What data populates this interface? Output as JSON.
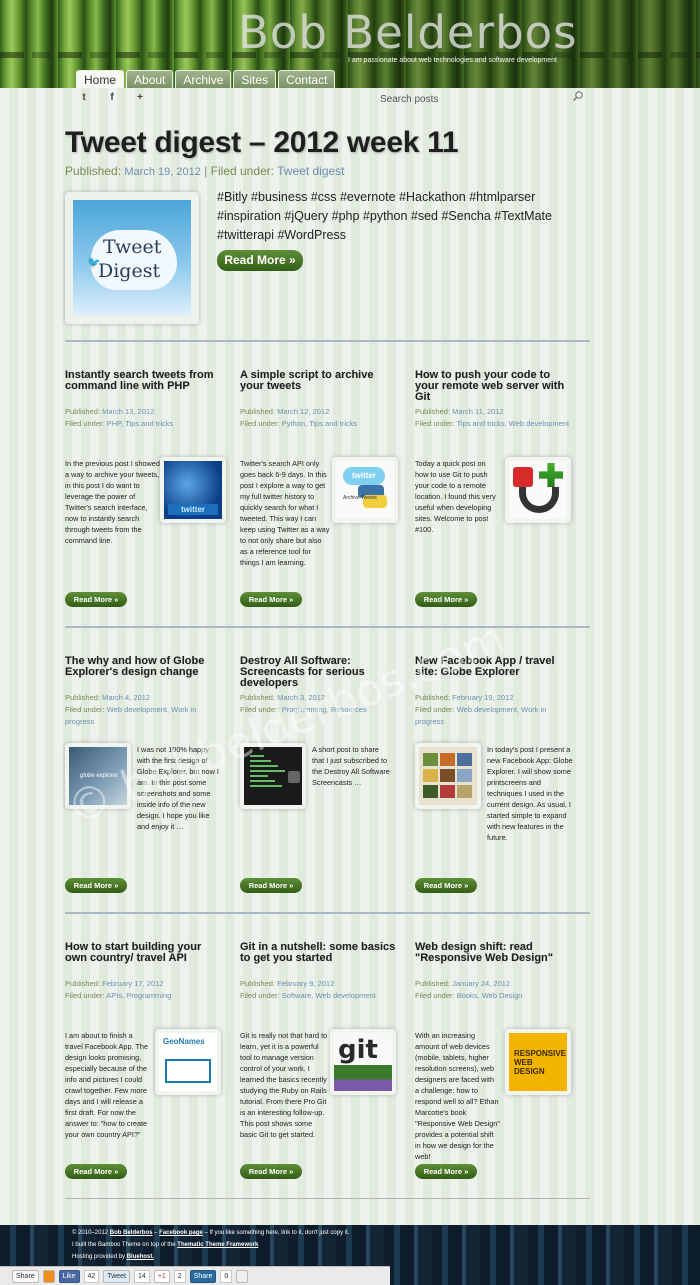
{
  "site": {
    "title": "Bob Belderbos",
    "description": "I am passionate about web technologies and software development"
  },
  "nav": {
    "tabs": [
      "Home",
      "About",
      "Archive",
      "Sites",
      "Contact"
    ],
    "active": "Home"
  },
  "social": [
    "t",
    "f",
    "+"
  ],
  "search": {
    "placeholder": "Search posts"
  },
  "featured": {
    "title": "Tweet digest – 2012 week 11",
    "published_label": "Published:",
    "date": "March 19, 2012",
    "separator": "|",
    "filed_label": "Filed under:",
    "category": "Tweet digest",
    "thumb_line1": "Tweet",
    "thumb_line2": "Digest",
    "tags": "#Bitly #business #css #evernote #Hackathon #htmlparser #inspiration #jQuery #php #python #sed #Sencha #TextMate #twitterapi #WordPress",
    "read_more": "Read More »"
  },
  "labels": {
    "published": "Published:",
    "filed": "Filed under:",
    "read_more": "Read More »"
  },
  "posts": [
    {
      "title": "Instantly search tweets from command line with PHP",
      "date": "March 13, 2012",
      "categories": "PHP, Tips and tricks",
      "excerpt": "In the previous post I showed a way to archive your tweets, in this post I do want to leverage the power of Twitter's search interface, now to instantly search through tweets from the command line.",
      "thumb_text": "twitter"
    },
    {
      "title": "A simple script to archive your tweets",
      "date": "March 12, 2012",
      "categories": "Python, Tips and tricks",
      "excerpt": "Twitter's search API only goes back 6-9 days. In this post I explore a way to get my full twitter history to quickly search for what I tweeted. This way I can keep using Twitter as a way to not only share but also as a reference tool for things I am learning.",
      "thumb_text": "twitter",
      "thumb_label": "Archive Tweets"
    },
    {
      "title": "How to push your code to your remote web server with Git",
      "date": "March 11, 2012",
      "categories": "Tips and tricks, Web development",
      "excerpt": "Today a quick post on how to use Git to push your code to a remote location. I found this very useful when developing sites. Welcome to post #100."
    },
    {
      "title": "The why and how of Globe Explorer's design change",
      "date": "March 4, 2012",
      "categories": "Web development, Work in progress",
      "excerpt": "I was not 100% happy with the first design of Globe Explorer, but now I am. In this post some screenshots and some inside info of the new design. I hope you like and enjoy it …",
      "thumb_text": "globe explorer"
    },
    {
      "title": "Destroy All Software: Screencasts for serious developers",
      "date": "March 3, 2012",
      "categories": "Programming, Resources",
      "excerpt": "A short post to share that I just subscribed to the Destroy All Software Screencasts …"
    },
    {
      "title": "New Facebook App / travel site: Globe Explorer",
      "date": "February 19, 2012",
      "categories": "Web development, Work in progress",
      "excerpt": "In today's post I present a new Facebook App: Globe Explorer. I will show some printscreens and techniques I used in the current design. As usual, I started simple to expand with new features in the future."
    },
    {
      "title": "How to start building your own country/ travel API",
      "date": "February 17, 2012",
      "categories": "APIs, Programming",
      "excerpt": "I am about to finish a travel Facebook App. The design looks promising, especially because of the info and pictures I could crawl together. Few more days and I will release a first draft. For now the answer to: \"how to create your own country API?\"",
      "thumb_text": "GeoNames"
    },
    {
      "title": "Git in a nutshell: some basics to get you started",
      "date": "February 9, 2012",
      "categories": "Software, Web development",
      "excerpt": "Git is really not that hard to learn, yet it is a powerful tool to manage version control of your work. I learned the basics recently studying the Ruby on Rails tutorial. From there Pro Git is an interesting follow-up. This post shows some basic Git to get started.",
      "thumb_text": "git"
    },
    {
      "title": "Web design shift: read \"Responsive Web Design\"",
      "date": "January 24, 2012",
      "categories": "Books, Web Design",
      "excerpt": "With an increasing amount of web devices (mobile, tablets, higher resolution screens), web designers are faced with a challenge: how to respond well to all? Ethan Marcotte's book \"Responsive Web Design\" provides a potential shift in how we design for the web!",
      "thumb_text": "RESPONSIVE WEB DESIGN"
    }
  ],
  "watermark": "© bobbelderbos.com",
  "footer": {
    "l1_pre": "© 2010–2012",
    "l1_name": "Bob Belderbos",
    "l1_sep": "–",
    "l1_fb": "Facebook page",
    "l1_rest": "– If you like something here, link to it, don't just copy it.",
    "l2_pre": "I built the Bamboo Theme on top of the",
    "l2_link": "Thematic Theme Framework",
    "l3_pre": "Hosting provided by",
    "l3_link": "Bluehost."
  },
  "sharebar": {
    "share": "Share",
    "like": "Like",
    "like_count": "42",
    "tweet": "Tweet",
    "tweet_count": "14",
    "plus": "+1",
    "plus_count": "2",
    "li_share": "Share",
    "li_count": "0"
  },
  "colors": {
    "accent_green": "#3f6e21",
    "link_blue": "#6e8fb0",
    "rule": "#a9b8c4"
  }
}
